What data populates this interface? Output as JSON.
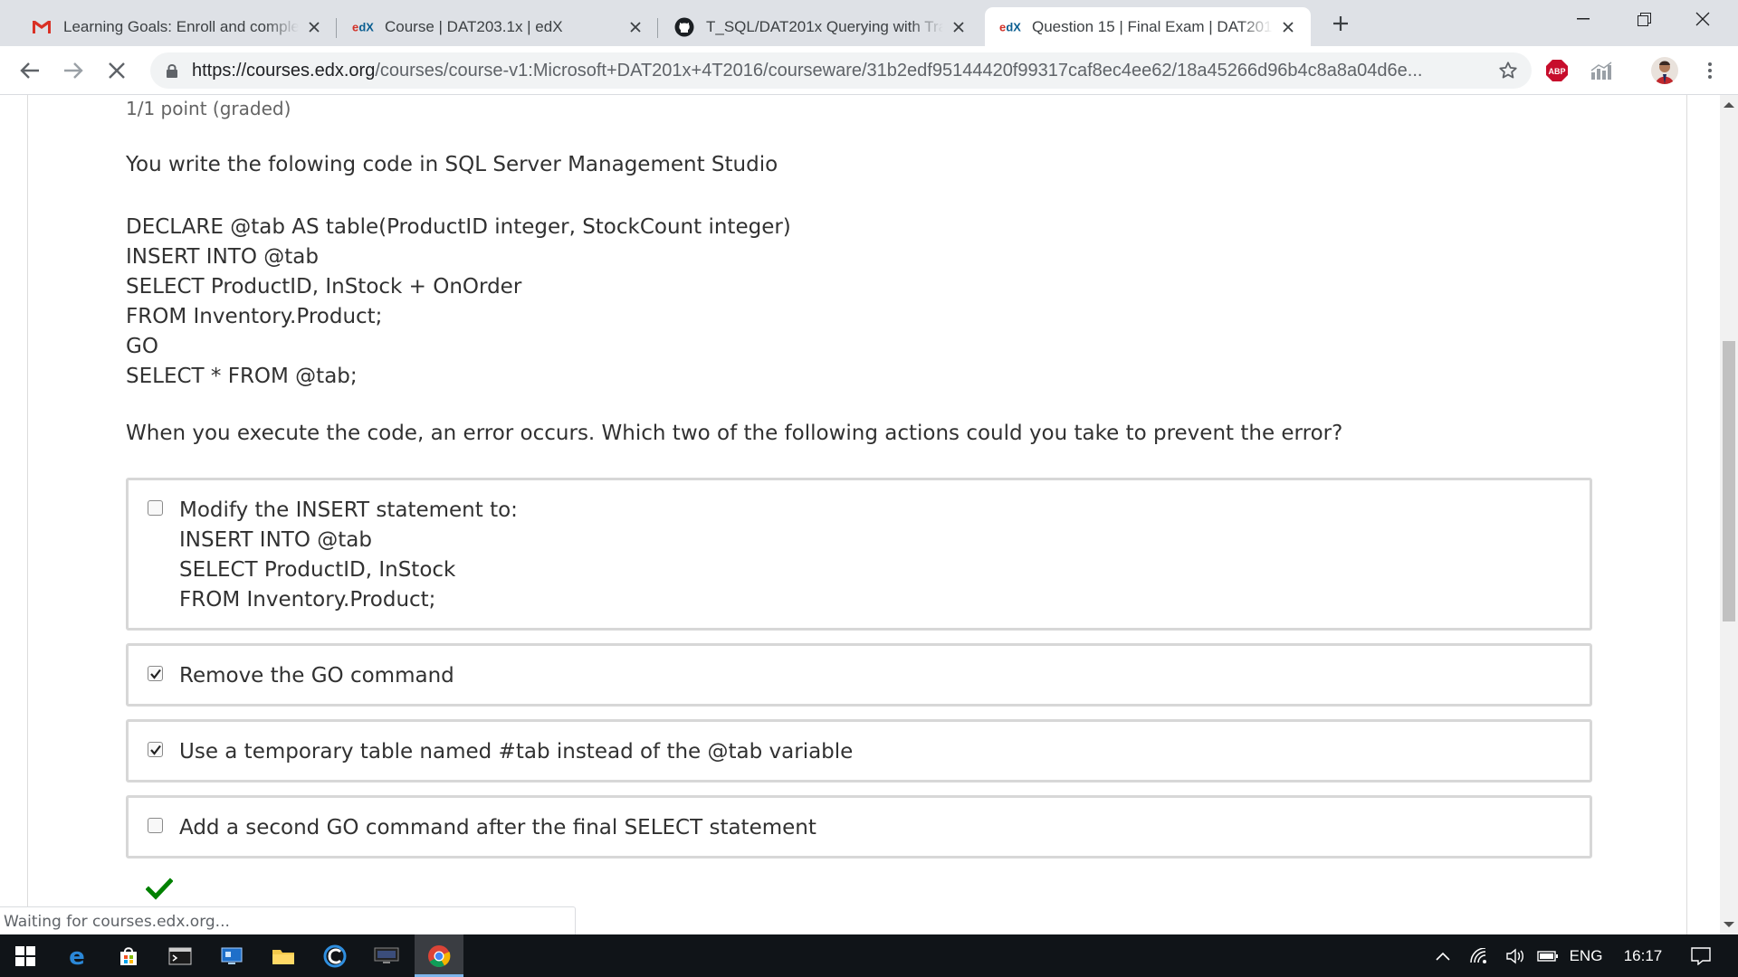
{
  "browser": {
    "tabs": [
      {
        "title": "Learning Goals: Enroll and complete",
        "favicon": "gmail-icon",
        "active": false
      },
      {
        "title": "Course | DAT203.1x | edX",
        "favicon": "edx-icon",
        "active": false
      },
      {
        "title": "T_SQL/DAT201x Querying with Transact-SQL",
        "favicon": "github-icon",
        "active": false
      },
      {
        "title": "Question 15 | Final Exam | DAT201x",
        "favicon": "edx-icon",
        "active": true
      }
    ],
    "url_host": "https://courses.edx.org",
    "url_path": "/courses/course-v1:Microsoft+DAT201x+4T2016/courseware/31b2edf95144420f99317caf8ec4ee62/18a45266d96b4c8a8a04d6e...",
    "status_text": "Waiting for courses.edx.org..."
  },
  "problem": {
    "points": "1/1 point (graded)",
    "intro": "You write the folowing code in SQL Server Management Studio",
    "code_lines": [
      "DECLARE @tab AS table(ProductID integer, StockCount integer)",
      "INSERT INTO @tab",
      "SELECT ProductID, InStock + OnOrder",
      "FROM Inventory.Product;",
      "GO",
      "SELECT * FROM @tab;"
    ],
    "question": "When you execute the code, an error occurs. Which two of the following actions could you take to prevent the error?",
    "options": [
      {
        "lines": [
          "Modify the INSERT statement to:",
          "INSERT INTO @tab",
          "SELECT ProductID, InStock",
          "FROM Inventory.Product;"
        ],
        "checked": false
      },
      {
        "lines": [
          "Remove the GO command"
        ],
        "checked": true
      },
      {
        "lines": [
          "Use a temporary table named #tab instead of the @tab variable"
        ],
        "checked": true
      },
      {
        "lines": [
          "Add a second GO command after the final SELECT statement"
        ],
        "checked": false
      }
    ],
    "result_icon": "checkmark-icon"
  },
  "taskbar": {
    "icons": [
      "windows-start-icon",
      "edge-icon",
      "store-icon",
      "terminal-icon",
      "remote-desktop-icon",
      "file-explorer-icon",
      "ccleaner-icon",
      "tv-app-icon",
      "chrome-icon"
    ],
    "language": "ENG",
    "time": "16:17"
  },
  "colors": {
    "tabstrip": "#dee1e6",
    "text": "#313131",
    "option_border": "#d7d7d7",
    "correct_green": "#008100",
    "taskbar": "#101418"
  }
}
